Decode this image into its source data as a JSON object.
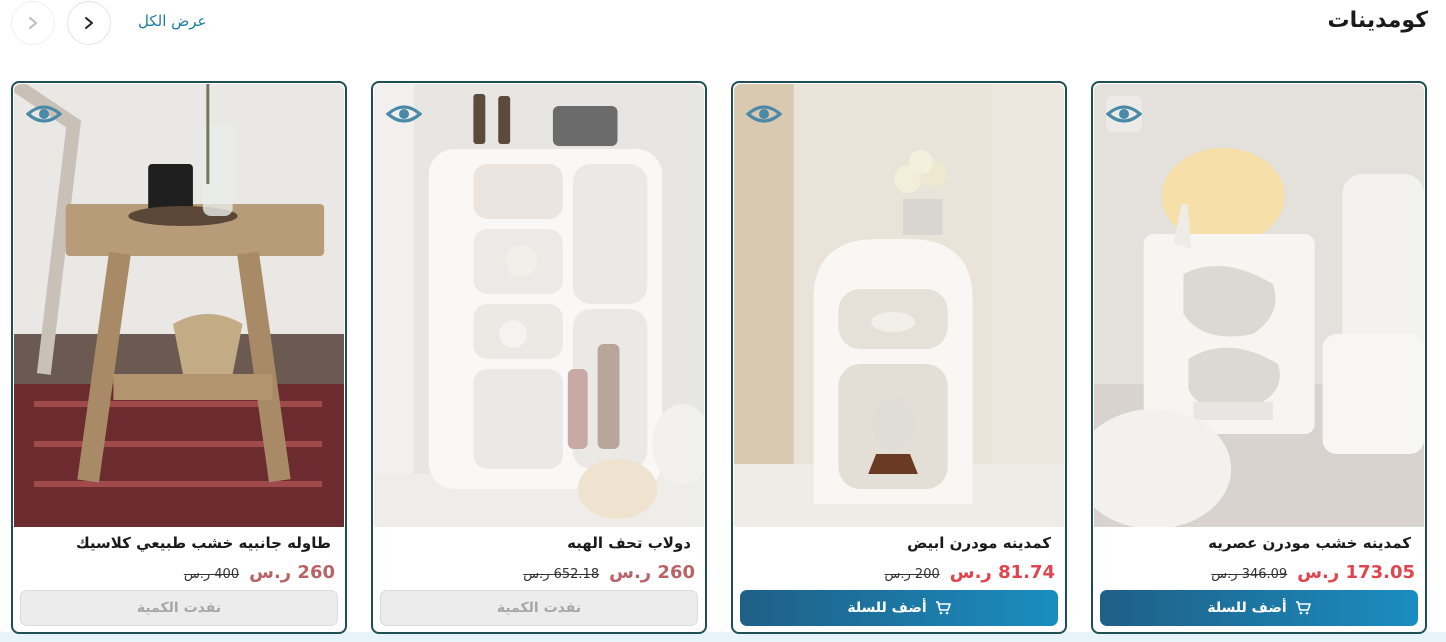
{
  "section": {
    "title": "كومدينات",
    "view_all": "عرض الكل"
  },
  "icons": {
    "prev": "chevron-right-icon",
    "next": "chevron-left-icon",
    "quick_view": "eye-icon",
    "cart": "cart-icon"
  },
  "colors": {
    "accent": "#1b7fa0",
    "border": "#1f4f55",
    "sale_price": "#e0454e",
    "regular_price": "#b86466",
    "button": "#1a8dc0"
  },
  "products": [
    {
      "name": "كمدينه خشب مودرن عصريه",
      "price": "173.05 ر.س",
      "old_price": "346.09 ر.س",
      "button": "أضف للسلة",
      "in_stock": true
    },
    {
      "name": "كمدينه مودرن ابيض",
      "price": "81.74 ر.س",
      "old_price": "200 ر.س",
      "button": "أضف للسلة",
      "in_stock": true
    },
    {
      "name": "دولاب تحف الهبه",
      "price": "260 ر.س",
      "old_price": "652.18 ر.س",
      "button": "نفدت الكمية",
      "in_stock": false
    },
    {
      "name": "طاوله جانبيه خشب طبيعي كلاسيك",
      "price": "260 ر.س",
      "old_price": "400 ر.س",
      "button": "نفدت الكمية",
      "in_stock": false
    }
  ]
}
